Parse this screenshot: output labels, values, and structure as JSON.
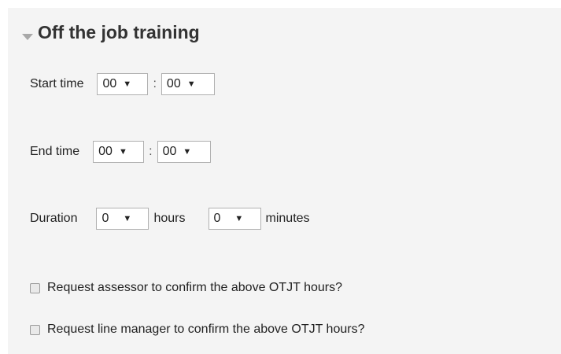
{
  "section": {
    "title": "Off the job training"
  },
  "start_time": {
    "label": "Start time",
    "hours": "00",
    "minutes": "00",
    "separator": ":"
  },
  "end_time": {
    "label": "End time",
    "hours": "00",
    "minutes": "00",
    "separator": ":"
  },
  "duration": {
    "label": "Duration",
    "hours_value": "0",
    "hours_unit": "hours",
    "minutes_value": "0",
    "minutes_unit": "minutes"
  },
  "checkboxes": [
    {
      "label": "Request assessor to confirm the above OTJT hours?",
      "checked": false
    },
    {
      "label": "Request line manager to confirm the above OTJT hours?",
      "checked": false
    }
  ],
  "icons": {
    "collapse": "triangle-down-icon",
    "dropdown": "chevron-down-icon"
  }
}
